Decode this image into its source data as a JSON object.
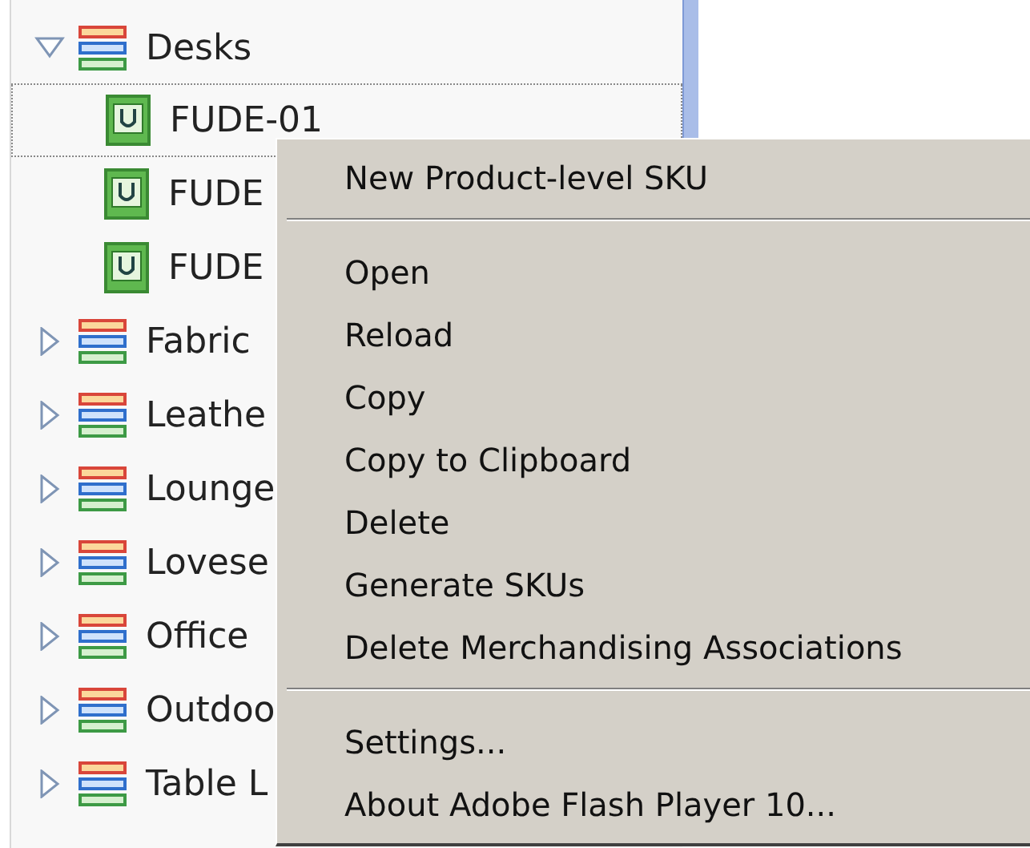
{
  "tree": [
    {
      "label": "Desks",
      "expanded": true,
      "selected": false,
      "children": [
        {
          "label": "FUDE-01",
          "selected": true
        },
        {
          "label": "FUDE",
          "selected": false
        },
        {
          "label": "FUDE",
          "selected": false
        }
      ]
    },
    {
      "label": "Fabric",
      "expanded": false,
      "selected": false
    },
    {
      "label": "Leathe",
      "expanded": false,
      "selected": false
    },
    {
      "label": "Lounge",
      "expanded": false,
      "selected": false
    },
    {
      "label": "Lovese",
      "expanded": false,
      "selected": false
    },
    {
      "label": "Office",
      "expanded": false,
      "selected": false
    },
    {
      "label": "Outdoo",
      "expanded": false,
      "selected": false
    },
    {
      "label": "Table L",
      "expanded": false,
      "selected": false
    }
  ],
  "context_menu": [
    {
      "kind": "item",
      "label": "New Product-level SKU"
    },
    {
      "kind": "separator"
    },
    {
      "kind": "item",
      "label": "Open"
    },
    {
      "kind": "item",
      "label": "Reload"
    },
    {
      "kind": "item",
      "label": "Copy"
    },
    {
      "kind": "item",
      "label": "Copy to Clipboard"
    },
    {
      "kind": "item",
      "label": "Delete"
    },
    {
      "kind": "item",
      "label": "Generate SKUs"
    },
    {
      "kind": "item",
      "label": "Delete Merchandising Associations"
    },
    {
      "kind": "separator"
    },
    {
      "kind": "item",
      "label": "Settings..."
    },
    {
      "kind": "item",
      "label": "About Adobe Flash Player 10..."
    }
  ]
}
